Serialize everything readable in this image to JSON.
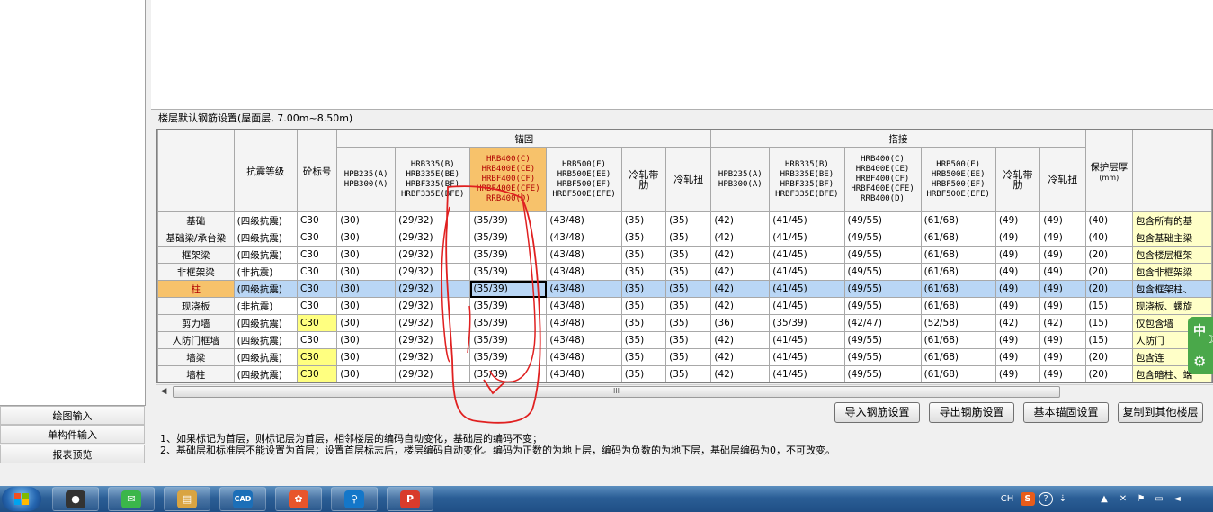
{
  "left_nav": {
    "items": [
      "绘图输入",
      "单构件输入",
      "报表预览"
    ]
  },
  "section_title": "楼层默认钢筋设置(屋面层, 7.00m~8.50m)",
  "table": {
    "group_anchor": "锚固",
    "group_lap": "搭接",
    "col_seismic": "抗震等级",
    "col_concrete": "砼标号",
    "col_cover": "保护层厚",
    "col_cover_unit": "(mm)",
    "grade_headers": [
      "HPB235(A)\nHPB300(A)",
      "HRB335(B)\nHRB335E(BE)\nHRBF335(BF)\nHRBF335E(BFE)",
      "HRB400(C)\nHRB400E(CE)\nHRBF400(CF)\nHRBF400E(CFE)\nRRB400(D)",
      "HRB500(E)\nHRB500E(EE)\nHRBF500(EF)\nHRBF500E(EFE)",
      "冷轧带肋",
      "冷轧扭"
    ],
    "rows": [
      {
        "name": "基础",
        "seismic": "(四级抗震)",
        "concrete": "C30",
        "a": [
          "(30)",
          "(29/32)",
          "(35/39)",
          "(43/48)",
          "(35)",
          "(35)"
        ],
        "l": [
          "(42)",
          "(41/45)",
          "(49/55)",
          "(61/68)",
          "(49)",
          "(49)"
        ],
        "cover": "(40)",
        "desc": "包含所有的基"
      },
      {
        "name": "基础梁/承台梁",
        "seismic": "(四级抗震)",
        "concrete": "C30",
        "a": [
          "(30)",
          "(29/32)",
          "(35/39)",
          "(43/48)",
          "(35)",
          "(35)"
        ],
        "l": [
          "(42)",
          "(41/45)",
          "(49/55)",
          "(61/68)",
          "(49)",
          "(49)"
        ],
        "cover": "(40)",
        "desc": "包含基础主梁"
      },
      {
        "name": "框架梁",
        "seismic": "(四级抗震)",
        "concrete": "C30",
        "a": [
          "(30)",
          "(29/32)",
          "(35/39)",
          "(43/48)",
          "(35)",
          "(35)"
        ],
        "l": [
          "(42)",
          "(41/45)",
          "(49/55)",
          "(61/68)",
          "(49)",
          "(49)"
        ],
        "cover": "(20)",
        "desc": "包含楼层框架"
      },
      {
        "name": "非框架梁",
        "seismic": "(非抗震)",
        "concrete": "C30",
        "a": [
          "(30)",
          "(29/32)",
          "(35/39)",
          "(43/48)",
          "(35)",
          "(35)"
        ],
        "l": [
          "(42)",
          "(41/45)",
          "(49/55)",
          "(61/68)",
          "(49)",
          "(49)"
        ],
        "cover": "(20)",
        "desc": "包含非框架梁"
      },
      {
        "name": "柱",
        "seismic": "(四级抗震)",
        "concrete": "C30",
        "a": [
          "(30)",
          "(29/32)",
          "(35/39)",
          "(43/48)",
          "(35)",
          "(35)"
        ],
        "l": [
          "(42)",
          "(41/45)",
          "(49/55)",
          "(61/68)",
          "(49)",
          "(49)"
        ],
        "cover": "(20)",
        "desc": "包含框架柱、"
      },
      {
        "name": "现浇板",
        "seismic": "(非抗震)",
        "concrete": "C30",
        "a": [
          "(30)",
          "(29/32)",
          "(35/39)",
          "(43/48)",
          "(35)",
          "(35)"
        ],
        "l": [
          "(42)",
          "(41/45)",
          "(49/55)",
          "(61/68)",
          "(49)",
          "(49)"
        ],
        "cover": "(15)",
        "desc": "现浇板、螺旋"
      },
      {
        "name": "剪力墙",
        "seismic": "(四级抗震)",
        "concrete": "C30",
        "a": [
          "(30)",
          "(29/32)",
          "(35/39)",
          "(43/48)",
          "(35)",
          "(35)"
        ],
        "l": [
          "(36)",
          "(35/39)",
          "(42/47)",
          "(52/58)",
          "(42)",
          "(42)"
        ],
        "cover": "(15)",
        "desc": "仅包含墙"
      },
      {
        "name": "人防门框墙",
        "seismic": "(四级抗震)",
        "concrete": "C30",
        "a": [
          "(30)",
          "(29/32)",
          "(35/39)",
          "(43/48)",
          "(35)",
          "(35)"
        ],
        "l": [
          "(42)",
          "(41/45)",
          "(49/55)",
          "(61/68)",
          "(49)",
          "(49)"
        ],
        "cover": "(15)",
        "desc": "人防门"
      },
      {
        "name": "墙梁",
        "seismic": "(四级抗震)",
        "concrete": "C30",
        "a": [
          "(30)",
          "(29/32)",
          "(35/39)",
          "(43/48)",
          "(35)",
          "(35)"
        ],
        "l": [
          "(42)",
          "(41/45)",
          "(49/55)",
          "(61/68)",
          "(49)",
          "(49)"
        ],
        "cover": "(20)",
        "desc": "包含连"
      },
      {
        "name": "墙柱",
        "seismic": "(四级抗震)",
        "concrete": "C30",
        "a": [
          "(30)",
          "(29/32)",
          "(35/39)",
          "(43/48)",
          "(35)",
          "(35)"
        ],
        "l": [
          "(42)",
          "(41/45)",
          "(49/55)",
          "(61/68)",
          "(49)",
          "(49)"
        ],
        "cover": "(20)",
        "desc": "包含暗柱、端"
      }
    ]
  },
  "buttons": {
    "import": "导入钢筋设置",
    "export": "导出钢筋设置",
    "basic_anchor": "基本锚固设置",
    "copy": "复制到其他楼层"
  },
  "notes": [
    "1、如果标记为首层，则标记层为首层，相邻楼层的编码自动变化，基础层的编码不变；",
    "2、基础层和标准层不能设置为首层；设置首层标志后，楼层编码自动变化。编码为正数的为地上层，编码为负数的为地下层，基础层编码为0，不可改变。"
  ],
  "scrollbar_grip": "III",
  "ime": {
    "zh": "中",
    "moon": "☽",
    "gear": "⚙"
  },
  "taskbar": {
    "apps": [
      {
        "icon": "user-icon",
        "glyph": "●"
      },
      {
        "icon": "wechat-icon",
        "glyph": "✉"
      },
      {
        "icon": "file-explorer-icon",
        "glyph": "▤"
      },
      {
        "icon": "cad-icon",
        "glyph": "CAD"
      },
      {
        "icon": "color-wheel-icon",
        "glyph": "✿"
      },
      {
        "icon": "share-icon",
        "glyph": "⚲"
      },
      {
        "icon": "wps-icon",
        "glyph": "P"
      }
    ],
    "tray_lang": "CH",
    "colors": {
      "taskbar": "#2b5e96",
      "selected_header": "#f7c26b",
      "selected_row": "#b9d6f5",
      "concrete_highlight": "#ffff80",
      "annotation": "#e02020"
    }
  }
}
